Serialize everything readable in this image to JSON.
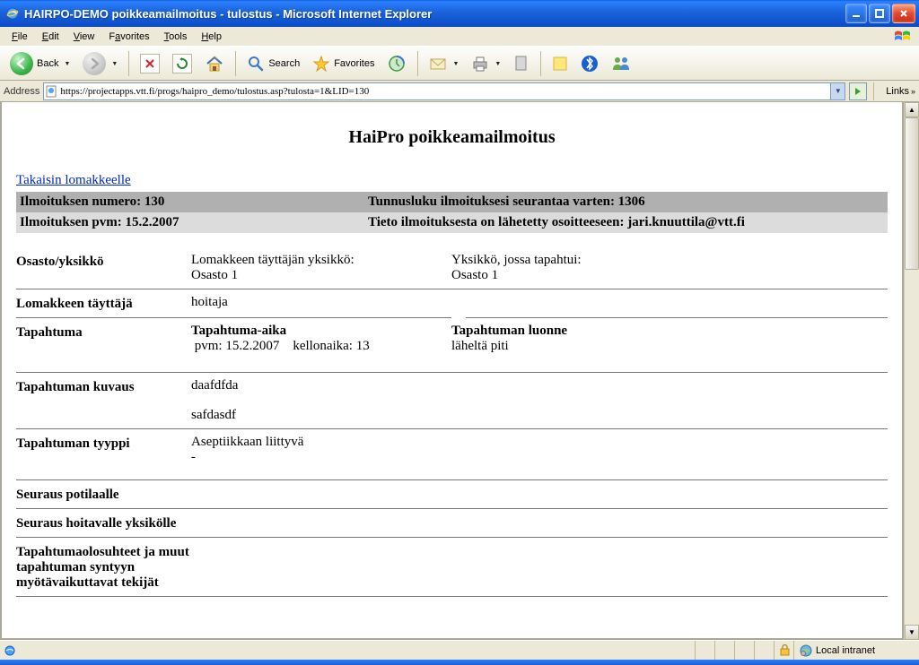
{
  "window": {
    "title": "HAIRPO-DEMO poikkeamailmoitus - tulostus - Microsoft Internet Explorer"
  },
  "menu": {
    "file": "File",
    "edit": "Edit",
    "view": "View",
    "favorites": "Favorites",
    "tools": "Tools",
    "help": "Help"
  },
  "toolbar": {
    "back": "Back",
    "search": "Search",
    "favorites": "Favorites"
  },
  "address": {
    "label": "Address",
    "url": "https://projectapps.vtt.fi/progs/haipro_demo/tulostus.asp?tulosta=1&LID=130",
    "links": "Links"
  },
  "status": {
    "zone": "Local intranet"
  },
  "doc": {
    "title": "HaiPro poikkeamailmoitus",
    "back_link": "Takaisin lomakkeelle",
    "r1_left": "Ilmoituksen numero: 130",
    "r1_right": "Tunnusluku ilmoituksesi seurantaa varten: 1306",
    "r2_left": "Ilmoituksen pvm: 15.2.2007",
    "r2_right": "Tieto ilmoituksesta on lähetetty osoitteeseen: jari.knuuttila@vtt.fi",
    "osasto_label": "Osasto/yksikkö",
    "osasto_mid_head": "Lomakkeen täyttäjän yksikkö:",
    "osasto_mid_val": "Osasto 1",
    "osasto_right_head": "Yksikkö, jossa tapahtui:",
    "osasto_right_val": "Osasto 1",
    "tayttaja_label": "Lomakkeen täyttäjä",
    "tayttaja_val": "hoitaja",
    "tapahtuma_label": "Tapahtuma",
    "tapahtuma_mid_head": "Tapahtuma-aika",
    "tapahtuma_mid_val": " pvm: 15.2.2007    kellonaika: 13",
    "tapahtuma_right_head": "Tapahtuman luonne",
    "tapahtuma_right_val": "läheltä piti",
    "kuvaus_label": "Tapahtuman kuvaus",
    "kuvaus_val1": "daafdfda",
    "kuvaus_val2": "safdasdf",
    "tyyppi_label": "Tapahtuman tyyppi",
    "tyyppi_val1": "Aseptiikkaan liittyvä",
    "tyyppi_val2": "-",
    "seuraus_pot": "Seuraus potilaalle",
    "seuraus_yks": "Seuraus hoitavalle yksikölle",
    "olosuhteet": "Tapahtumaolosuhteet ja muut tapahtuman syntyyn myötävaikuttavat tekijät"
  }
}
